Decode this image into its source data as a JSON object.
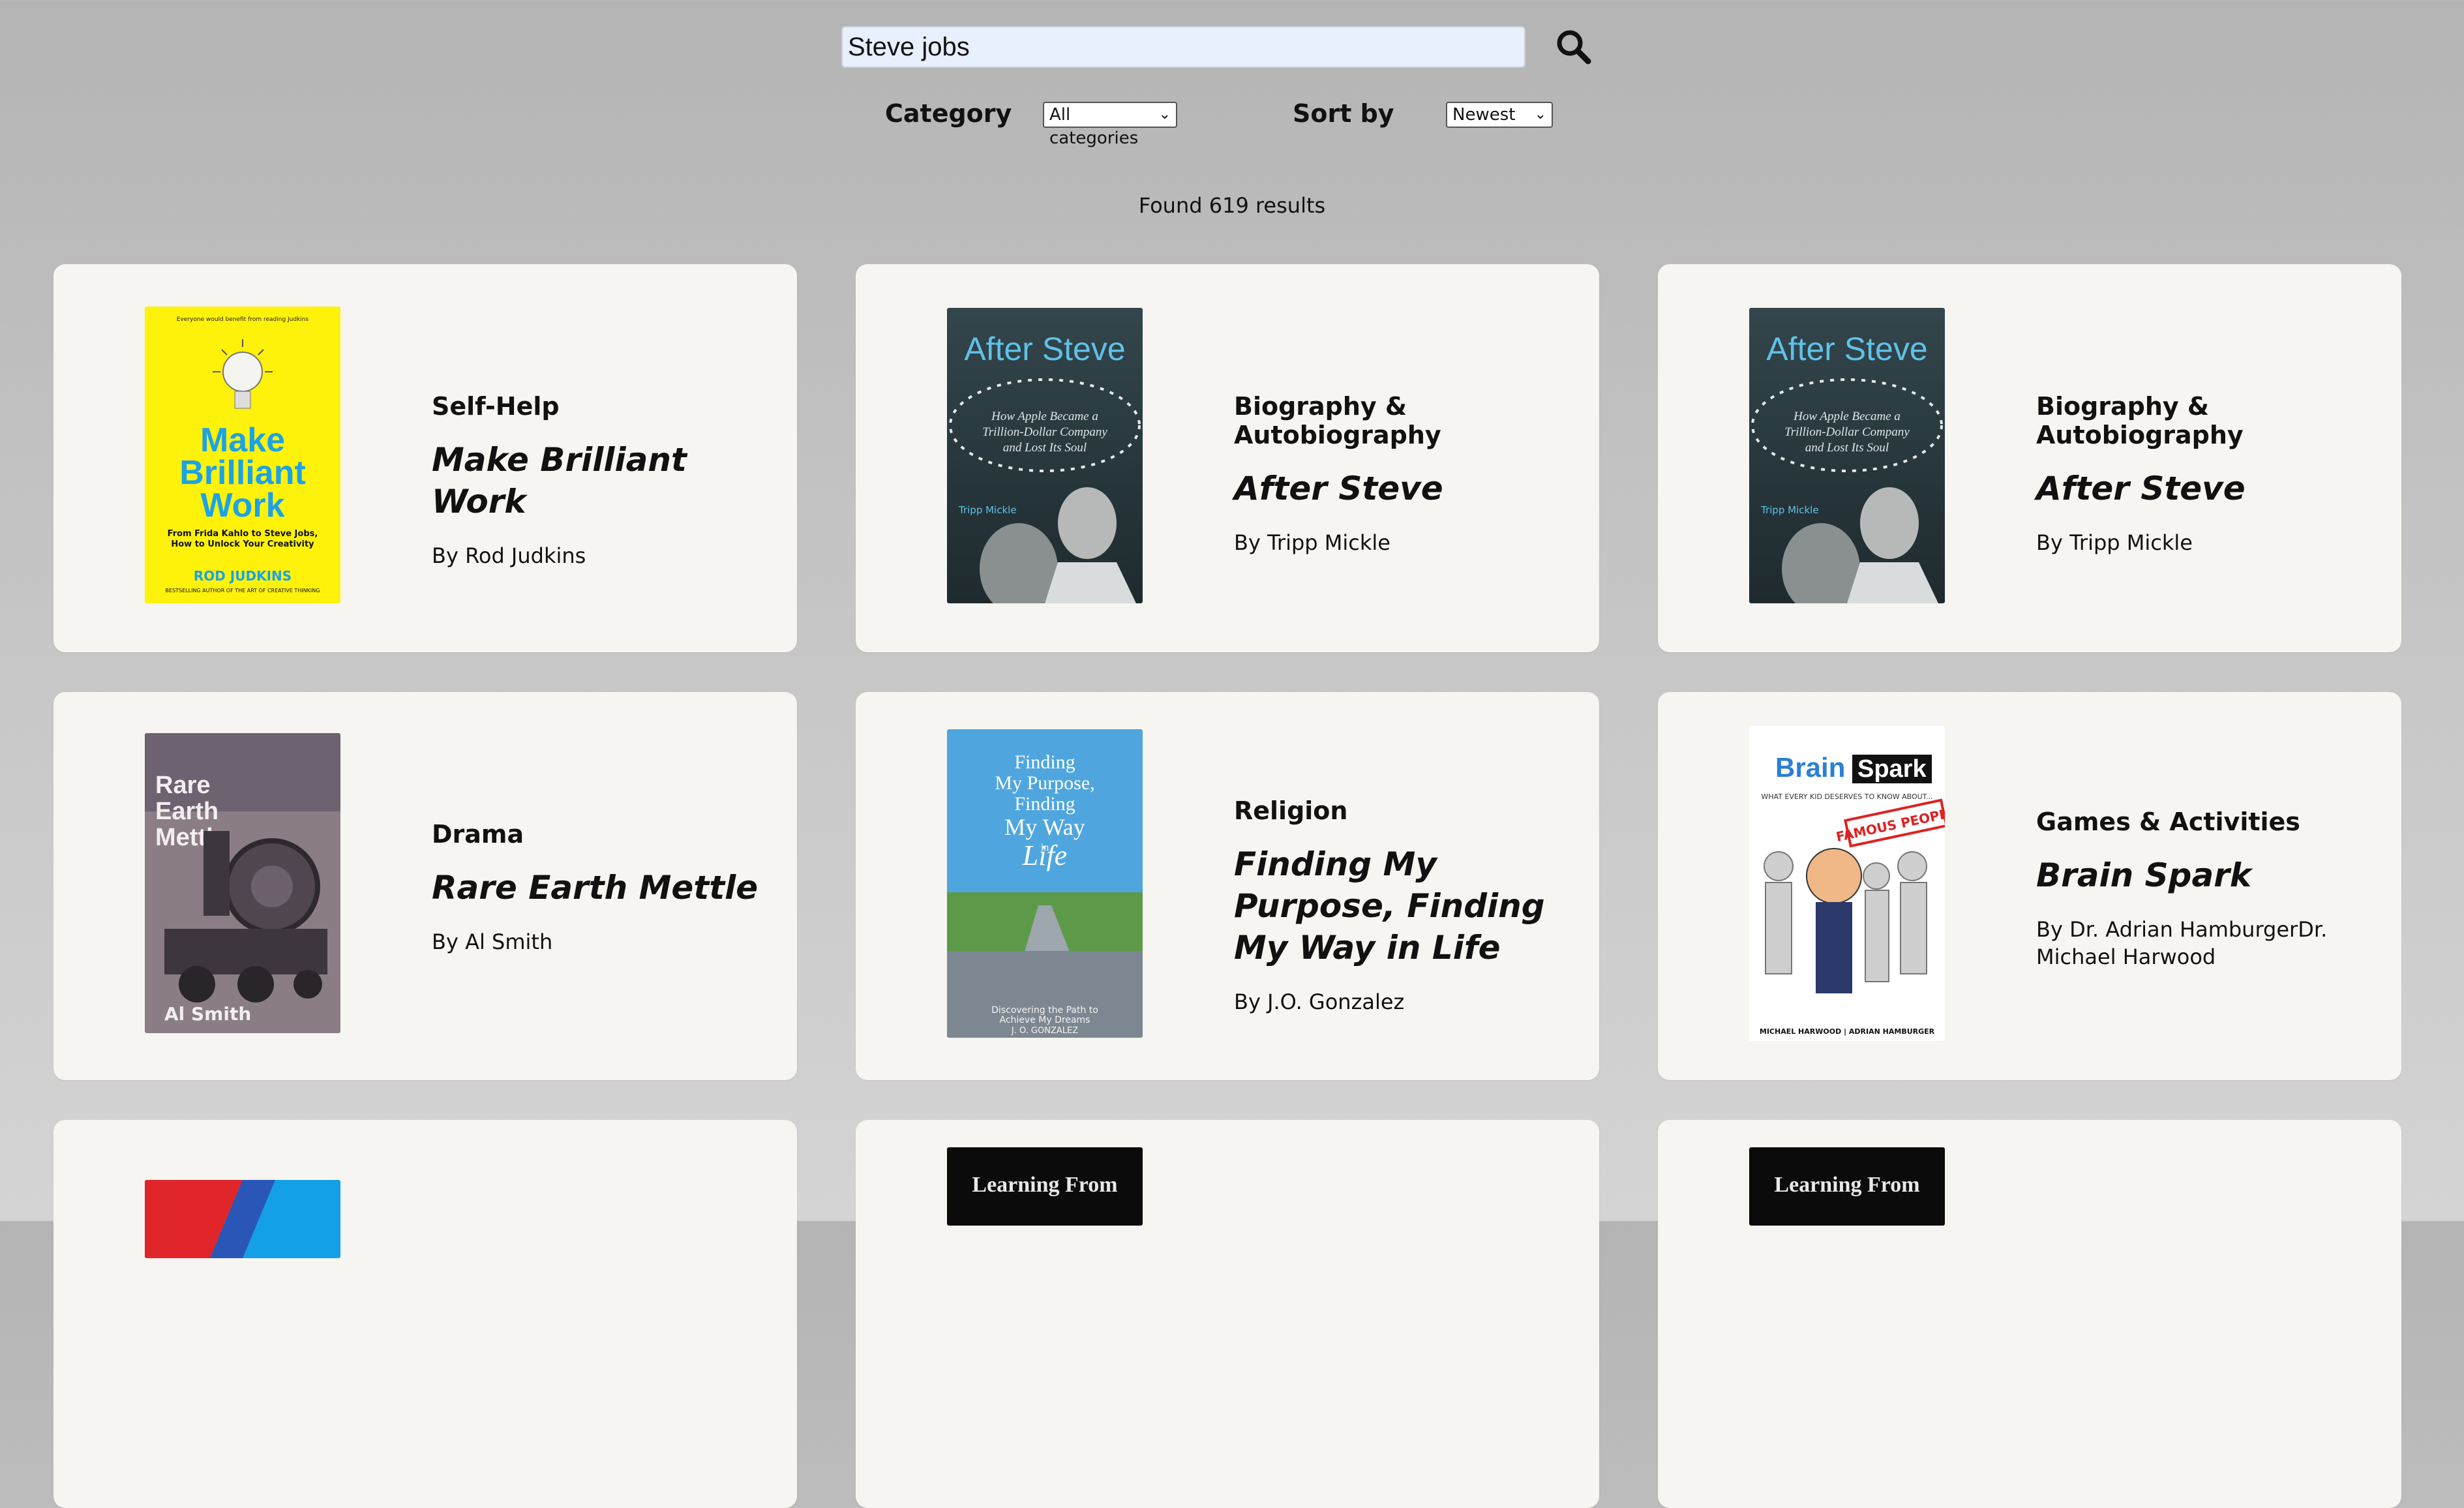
{
  "search": {
    "value": "Steve jobs"
  },
  "filters": {
    "category_label": "Category",
    "category_selected": "All categories",
    "sort_label": "Sort by",
    "sort_selected": "Newest"
  },
  "results_text": "Found 619 results",
  "books": [
    {
      "category": "Self-Help",
      "title": "Make Brilliant Work",
      "author": "By Rod Judkins",
      "cover": {
        "top_line": "Everyone would benefit from reading Judkins",
        "headline": [
          "Make",
          "Brilliant",
          "Work"
        ],
        "subtitle": [
          "From Frida Kahlo to Steve Jobs,",
          "How to Unlock Your Creativity"
        ],
        "author": "ROD JUDKINS",
        "tagline": "BESTSELLING AUTHOR OF THE ART OF CREATIVE THINKING"
      }
    },
    {
      "category": "Biography & Autobiography",
      "title": "After Steve",
      "author": "By Tripp Mickle",
      "cover": {
        "headline": "After Steve",
        "subtitle": [
          "How Apple Became a",
          "Trillion-Dollar Company",
          "and Lost Its Soul"
        ],
        "author": "Tripp Mickle"
      }
    },
    {
      "category": "Biography & Autobiography",
      "title": "After Steve",
      "author": "By Tripp Mickle",
      "cover": {
        "headline": "After Steve",
        "subtitle": [
          "How Apple Became a",
          "Trillion-Dollar Company",
          "and Lost Its Soul"
        ],
        "author": "Tripp Mickle"
      }
    },
    {
      "category": "Drama",
      "title": "Rare Earth Mettle",
      "author": "By Al Smith",
      "cover": {
        "headline": [
          "Rare",
          "Earth",
          "Mettle"
        ],
        "author": "Al Smith"
      }
    },
    {
      "category": "Religion",
      "title": "Finding My Purpose, Finding My Way in Life",
      "author": "By J.O. Gonzalez",
      "cover": {
        "headline": [
          "Finding",
          "My Purpose,",
          "Finding",
          "My Way",
          "in",
          "Life"
        ],
        "subtitle": [
          "Discovering the Path to",
          "Achieve My Dreams"
        ],
        "author": "J. O. GONZALEZ"
      }
    },
    {
      "category": "Games & Activities",
      "title": "Brain Spark",
      "author": "By Dr. Adrian HamburgerDr. Michael Harwood",
      "cover": {
        "headline": [
          "Brain",
          "Spark"
        ],
        "subtitle": "WHAT EVERY KID DESERVES TO KNOW ABOUT...",
        "banner": "FAMOUS PEOPLE",
        "author": "MICHAEL HARWOOD | ADRIAN HAMBURGER"
      }
    },
    {
      "cover": {}
    },
    {
      "cover": {
        "headline": "Learning From"
      }
    },
    {
      "cover": {
        "headline": "Learning From"
      }
    }
  ]
}
